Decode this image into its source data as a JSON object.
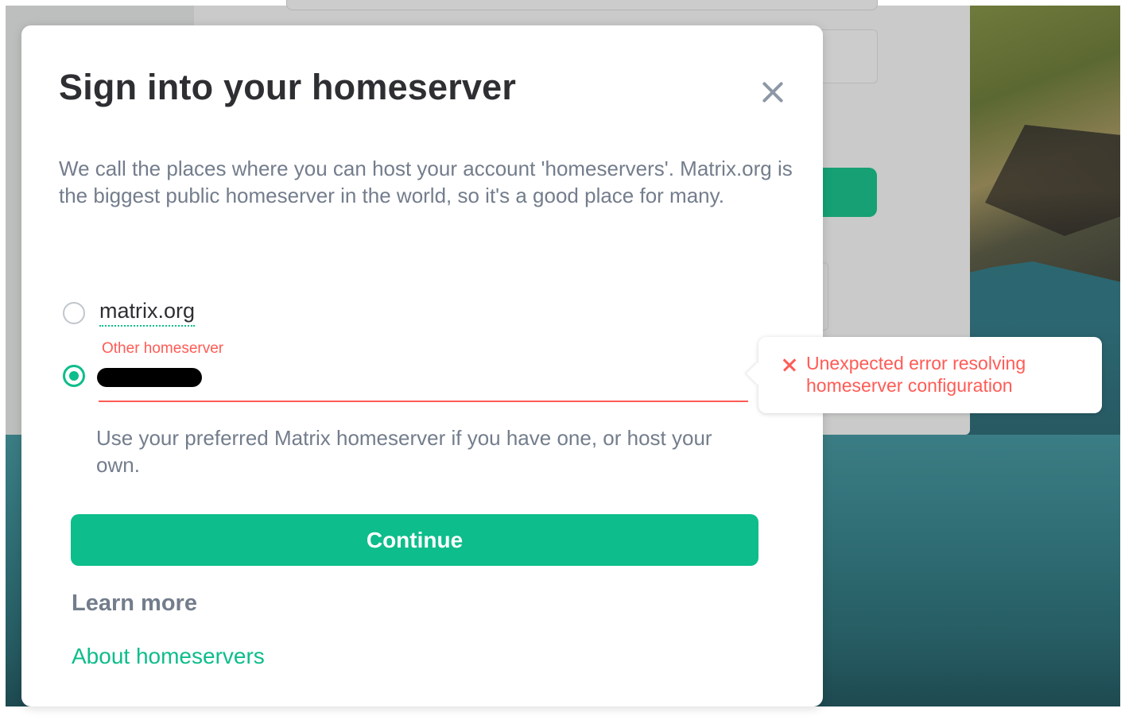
{
  "dialog": {
    "title": "Sign into your homeserver",
    "intro": "We call the places where you can host your account 'homeservers'. Matrix.org is the biggest public homeserver in the world, so it's a good place for many.",
    "options": {
      "matrix_label": "matrix.org",
      "other_field_label": "Other homeserver",
      "other_value": ""
    },
    "hint": "Use your preferred Matrix homeserver if you have one, or host your own.",
    "continue_label": "Continue",
    "learn_more_heading": "Learn more",
    "about_link": "About homeservers"
  },
  "error_tooltip": {
    "message": "Unexpected error resolving homeserver configuration"
  },
  "colors": {
    "accent": "#0dbd8b",
    "error": "#ff5b55",
    "text_primary": "#2e2f32",
    "text_secondary": "#737d8c"
  },
  "icons": [
    "close-icon",
    "error-x-icon"
  ]
}
